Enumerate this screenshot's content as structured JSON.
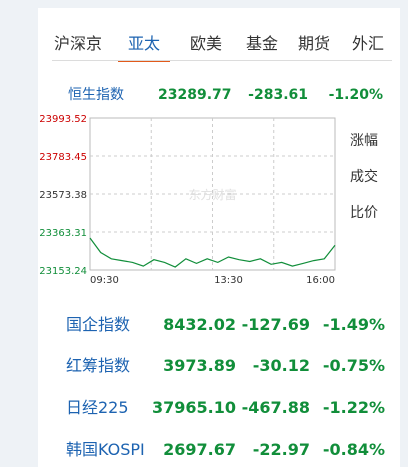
{
  "tabs": [
    {
      "label": "沪深京",
      "active": false
    },
    {
      "label": "亚太",
      "active": true
    },
    {
      "label": "欧美",
      "active": false
    },
    {
      "label": "基金",
      "active": false
    },
    {
      "label": "期货",
      "active": false
    },
    {
      "label": "外汇",
      "active": false
    }
  ],
  "hsi": {
    "name": "恒生指数",
    "value": "23289.77",
    "change": "-283.61",
    "percent": "-1.20%"
  },
  "chart_buttons": [
    "涨幅",
    "成交",
    "比价"
  ],
  "watermark": "东方财富",
  "colors": {
    "accent": "#1d63b1",
    "down": "#118e3a",
    "up_axis": "#cc0000",
    "tab_underline": "#e25a1a"
  },
  "chart_data": {
    "type": "line",
    "y_ticks": [
      "23993.52",
      "23783.45",
      "23573.38",
      "23363.31",
      "23153.24"
    ],
    "x_ticks": [
      "09:30",
      "13:30",
      "16:00"
    ],
    "ylim": [
      23153.24,
      23993.52
    ],
    "grid": true,
    "x": [
      "09:30",
      "09:45",
      "10:00",
      "10:15",
      "10:30",
      "10:45",
      "11:00",
      "11:15",
      "11:30",
      "11:45",
      "12:00",
      "13:00",
      "13:15",
      "13:30",
      "13:45",
      "14:00",
      "14:15",
      "14:30",
      "14:45",
      "15:00",
      "15:15",
      "15:30",
      "15:45",
      "16:00"
    ],
    "series": [
      {
        "values": [
          23330,
          23250,
          23215,
          23205,
          23195,
          23175,
          23210,
          23195,
          23170,
          23215,
          23190,
          23215,
          23195,
          23225,
          23210,
          23200,
          23215,
          23185,
          23195,
          23175,
          23190,
          23205,
          23215,
          23290
        ]
      }
    ]
  },
  "rows": [
    {
      "name": "国企指数",
      "value": "8432.02",
      "change": "-127.69",
      "percent": "-1.49%"
    },
    {
      "name": "红筹指数",
      "value": "3973.89",
      "change": "-30.12",
      "percent": "-0.75%"
    },
    {
      "name": "日经225",
      "value": "37965.10",
      "change": "-467.88",
      "percent": "-1.22%"
    },
    {
      "name": "韩国KOSPI",
      "value": "2697.67",
      "change": "-22.97",
      "percent": "-0.84%"
    }
  ]
}
